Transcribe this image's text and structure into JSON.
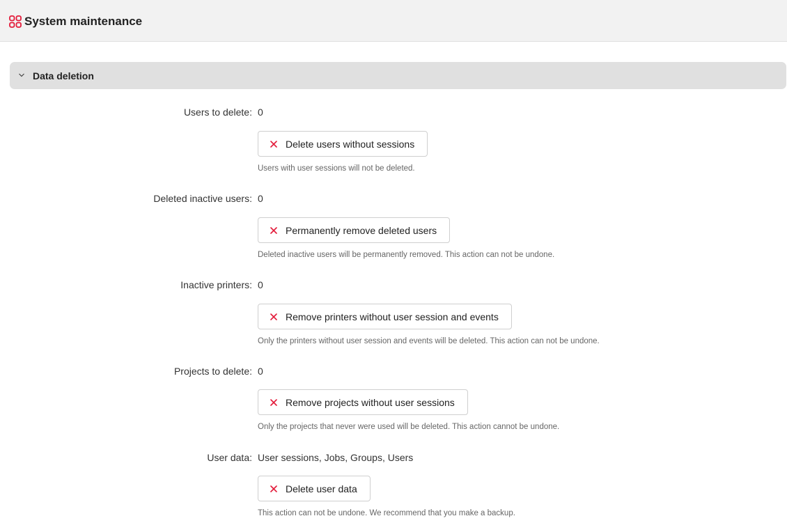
{
  "header": {
    "icon": "grid-icon",
    "title": "System maintenance",
    "accent_color": "#e31b3a"
  },
  "section": {
    "title": "Data deletion",
    "expanded": true
  },
  "rows": [
    {
      "label": "Users to delete:",
      "value": "0",
      "button": "Delete users without sessions",
      "note": "Users with user sessions will not be deleted."
    },
    {
      "label": "Deleted inactive users:",
      "value": "0",
      "button": "Permanently remove deleted users",
      "note": "Deleted inactive users will be permanently removed. This action can not be undone."
    },
    {
      "label": "Inactive printers:",
      "value": "0",
      "button": "Remove printers without user session and events",
      "note": "Only the printers without user session and events will be deleted. This action can not be undone."
    },
    {
      "label": "Projects to delete:",
      "value": "0",
      "button": "Remove projects without user sessions",
      "note": "Only the projects that never were used will be deleted. This action cannot be undone."
    },
    {
      "label": "User data:",
      "value": "User sessions, Jobs, Groups, Users",
      "button": "Delete user data",
      "note": "This action can not be undone. We recommend that you make a backup."
    }
  ]
}
